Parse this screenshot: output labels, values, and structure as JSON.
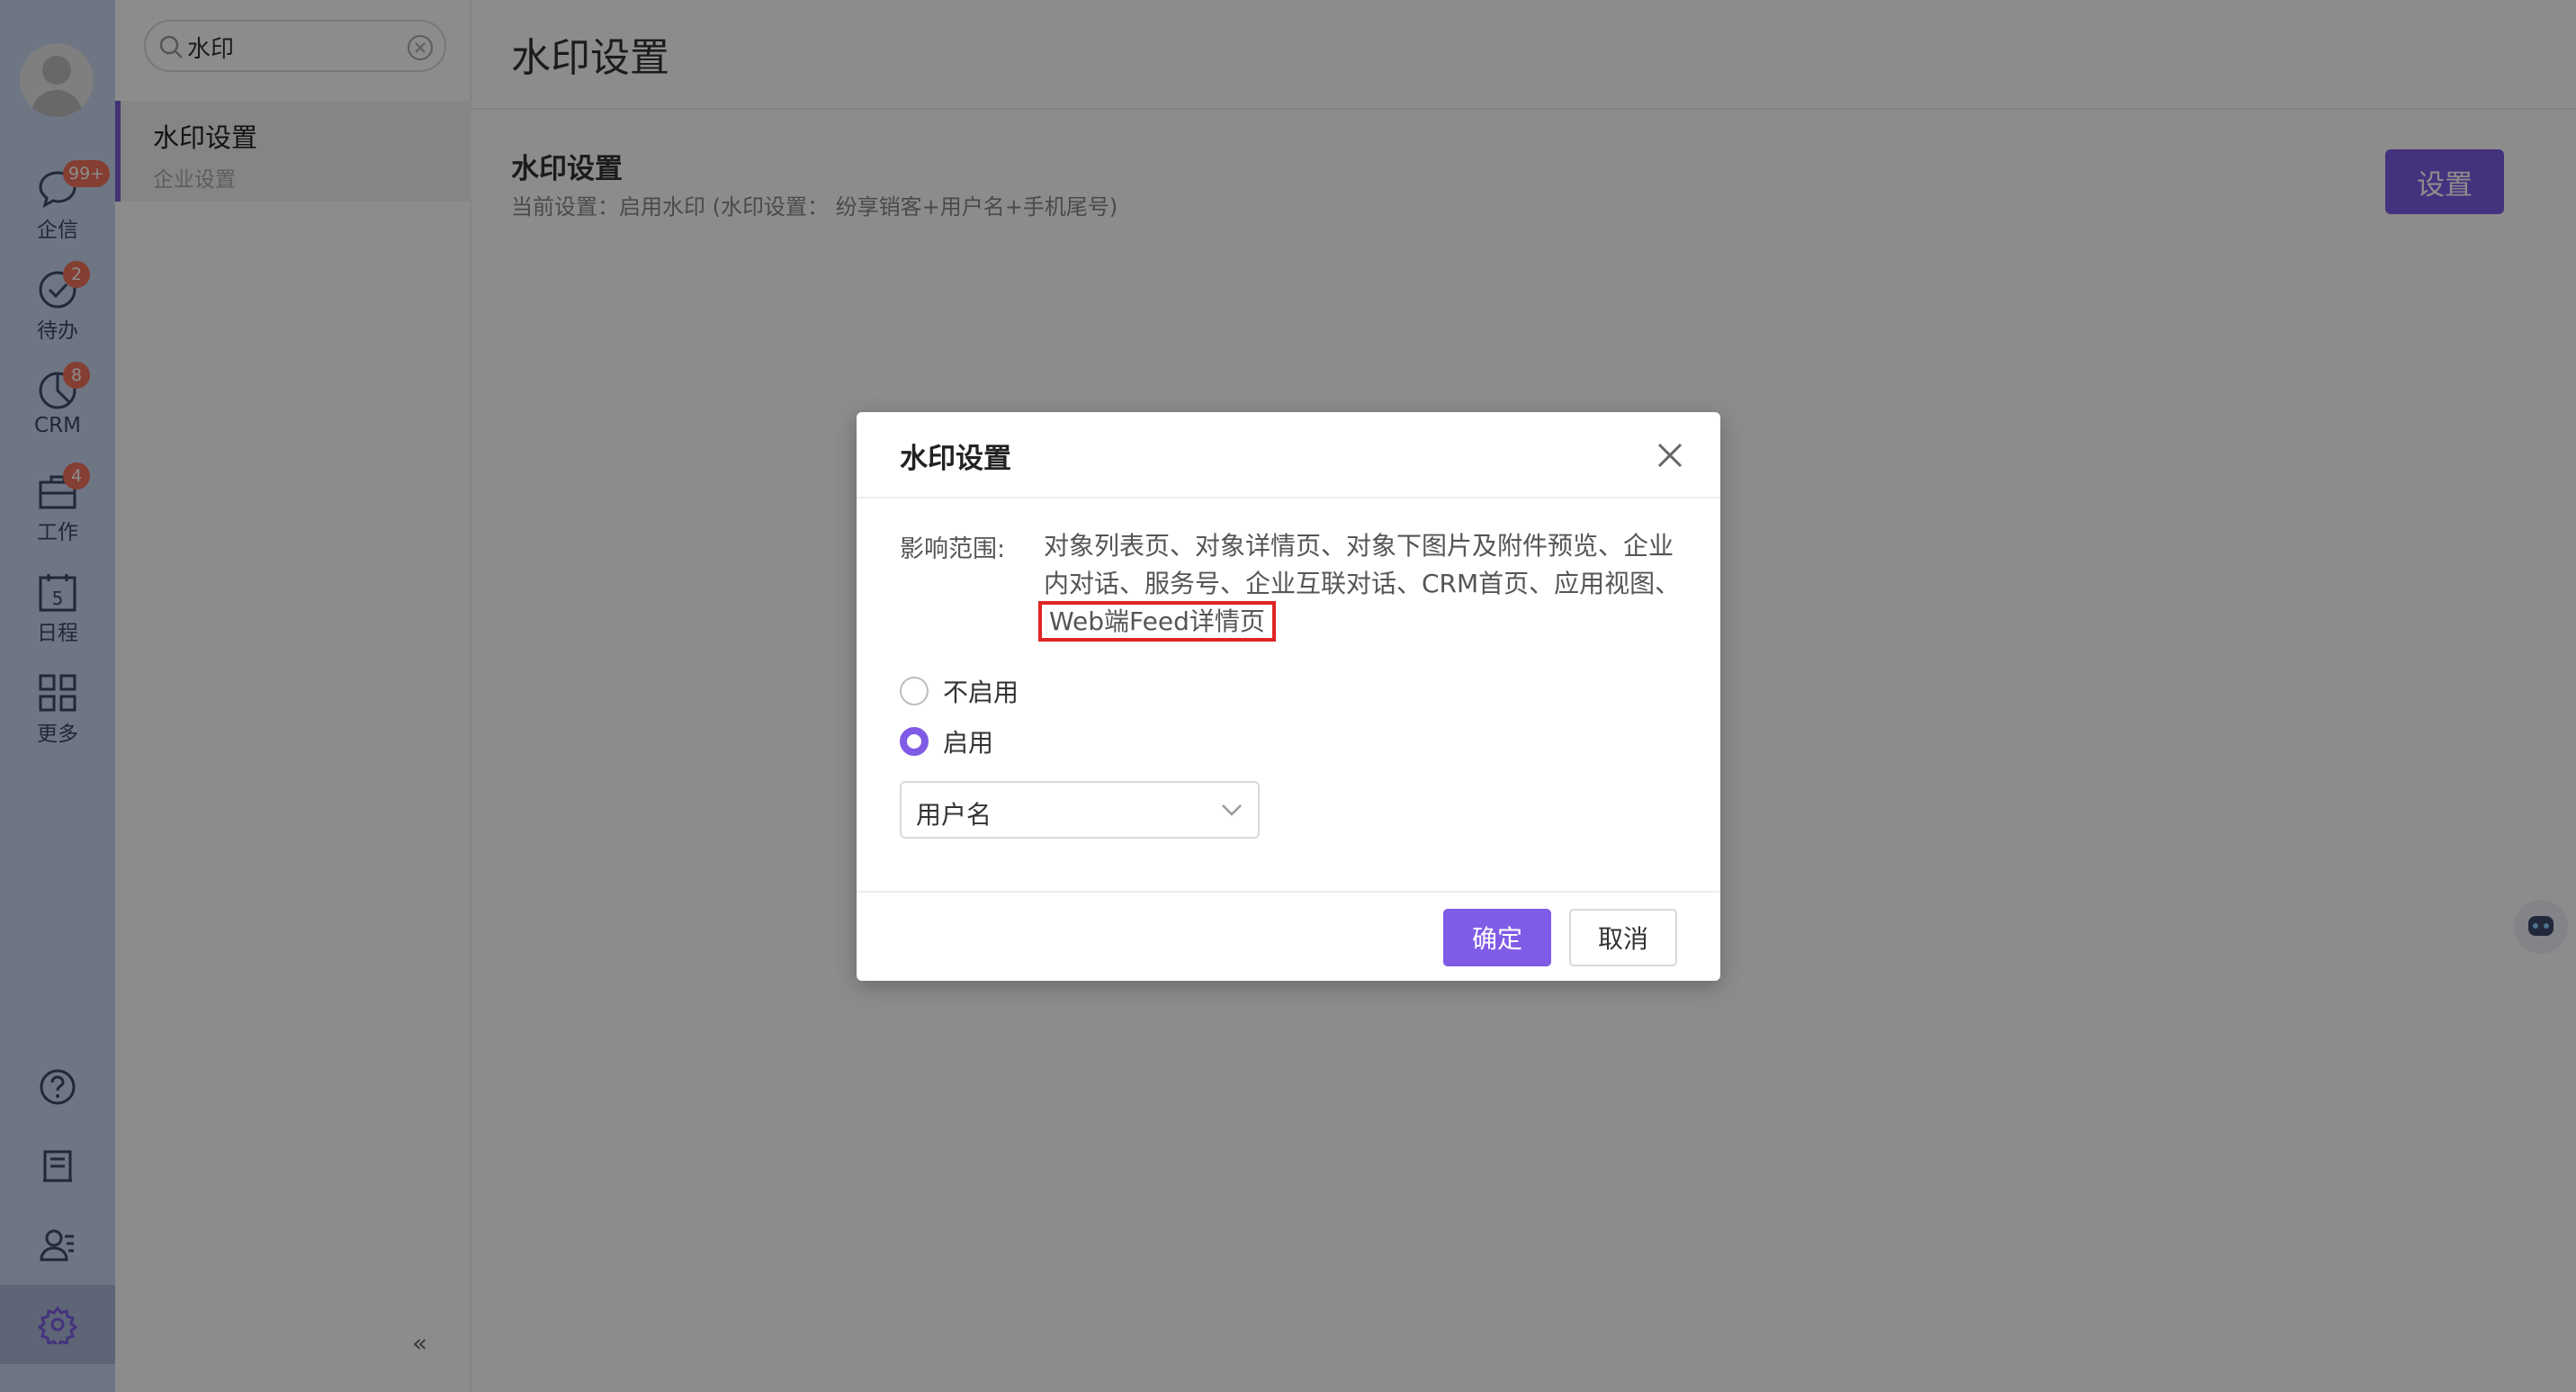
{
  "rail": {
    "items": [
      {
        "label": "企信",
        "badge": "99+",
        "icon": "chat-icon"
      },
      {
        "label": "待办",
        "badge": "2",
        "icon": "check-circle-icon"
      },
      {
        "label": "CRM",
        "badge": "8",
        "icon": "pie-chart-icon"
      },
      {
        "label": "工作",
        "badge": "4",
        "icon": "briefcase-icon"
      },
      {
        "label": "日程",
        "badge": "",
        "icon": "calendar-icon",
        "day": "5"
      },
      {
        "label": "更多",
        "badge": "",
        "icon": "grid-icon"
      }
    ],
    "bottom_icons": [
      "help-icon",
      "notebook-icon",
      "contacts-icon",
      "settings-icon"
    ]
  },
  "panel": {
    "search_value": "水印",
    "menu_item": {
      "title": "水印设置",
      "subtitle": "企业设置"
    }
  },
  "main": {
    "page_title": "水印设置",
    "section_title": "水印设置",
    "section_subtitle": "当前设置：启用水印 (水印设置： 纷享销客+用户名+手机尾号)",
    "set_button": "设置"
  },
  "dialog": {
    "title": "水印设置",
    "scope_label": "影响范围:",
    "scope_text": "对象列表页、对象详情页、对象下图片及附件预览、企业内对话、服务号、企业互联对话、CRM首页、应用视图、",
    "scope_highlight": "Web端Feed详情页",
    "options": [
      {
        "label": "不启用",
        "selected": false
      },
      {
        "label": "启用",
        "selected": true
      }
    ],
    "select_value": "用户名",
    "ok": "确定",
    "cancel": "取消"
  },
  "colors": {
    "accent": "#7f5be6",
    "highlight": "#e02424"
  }
}
